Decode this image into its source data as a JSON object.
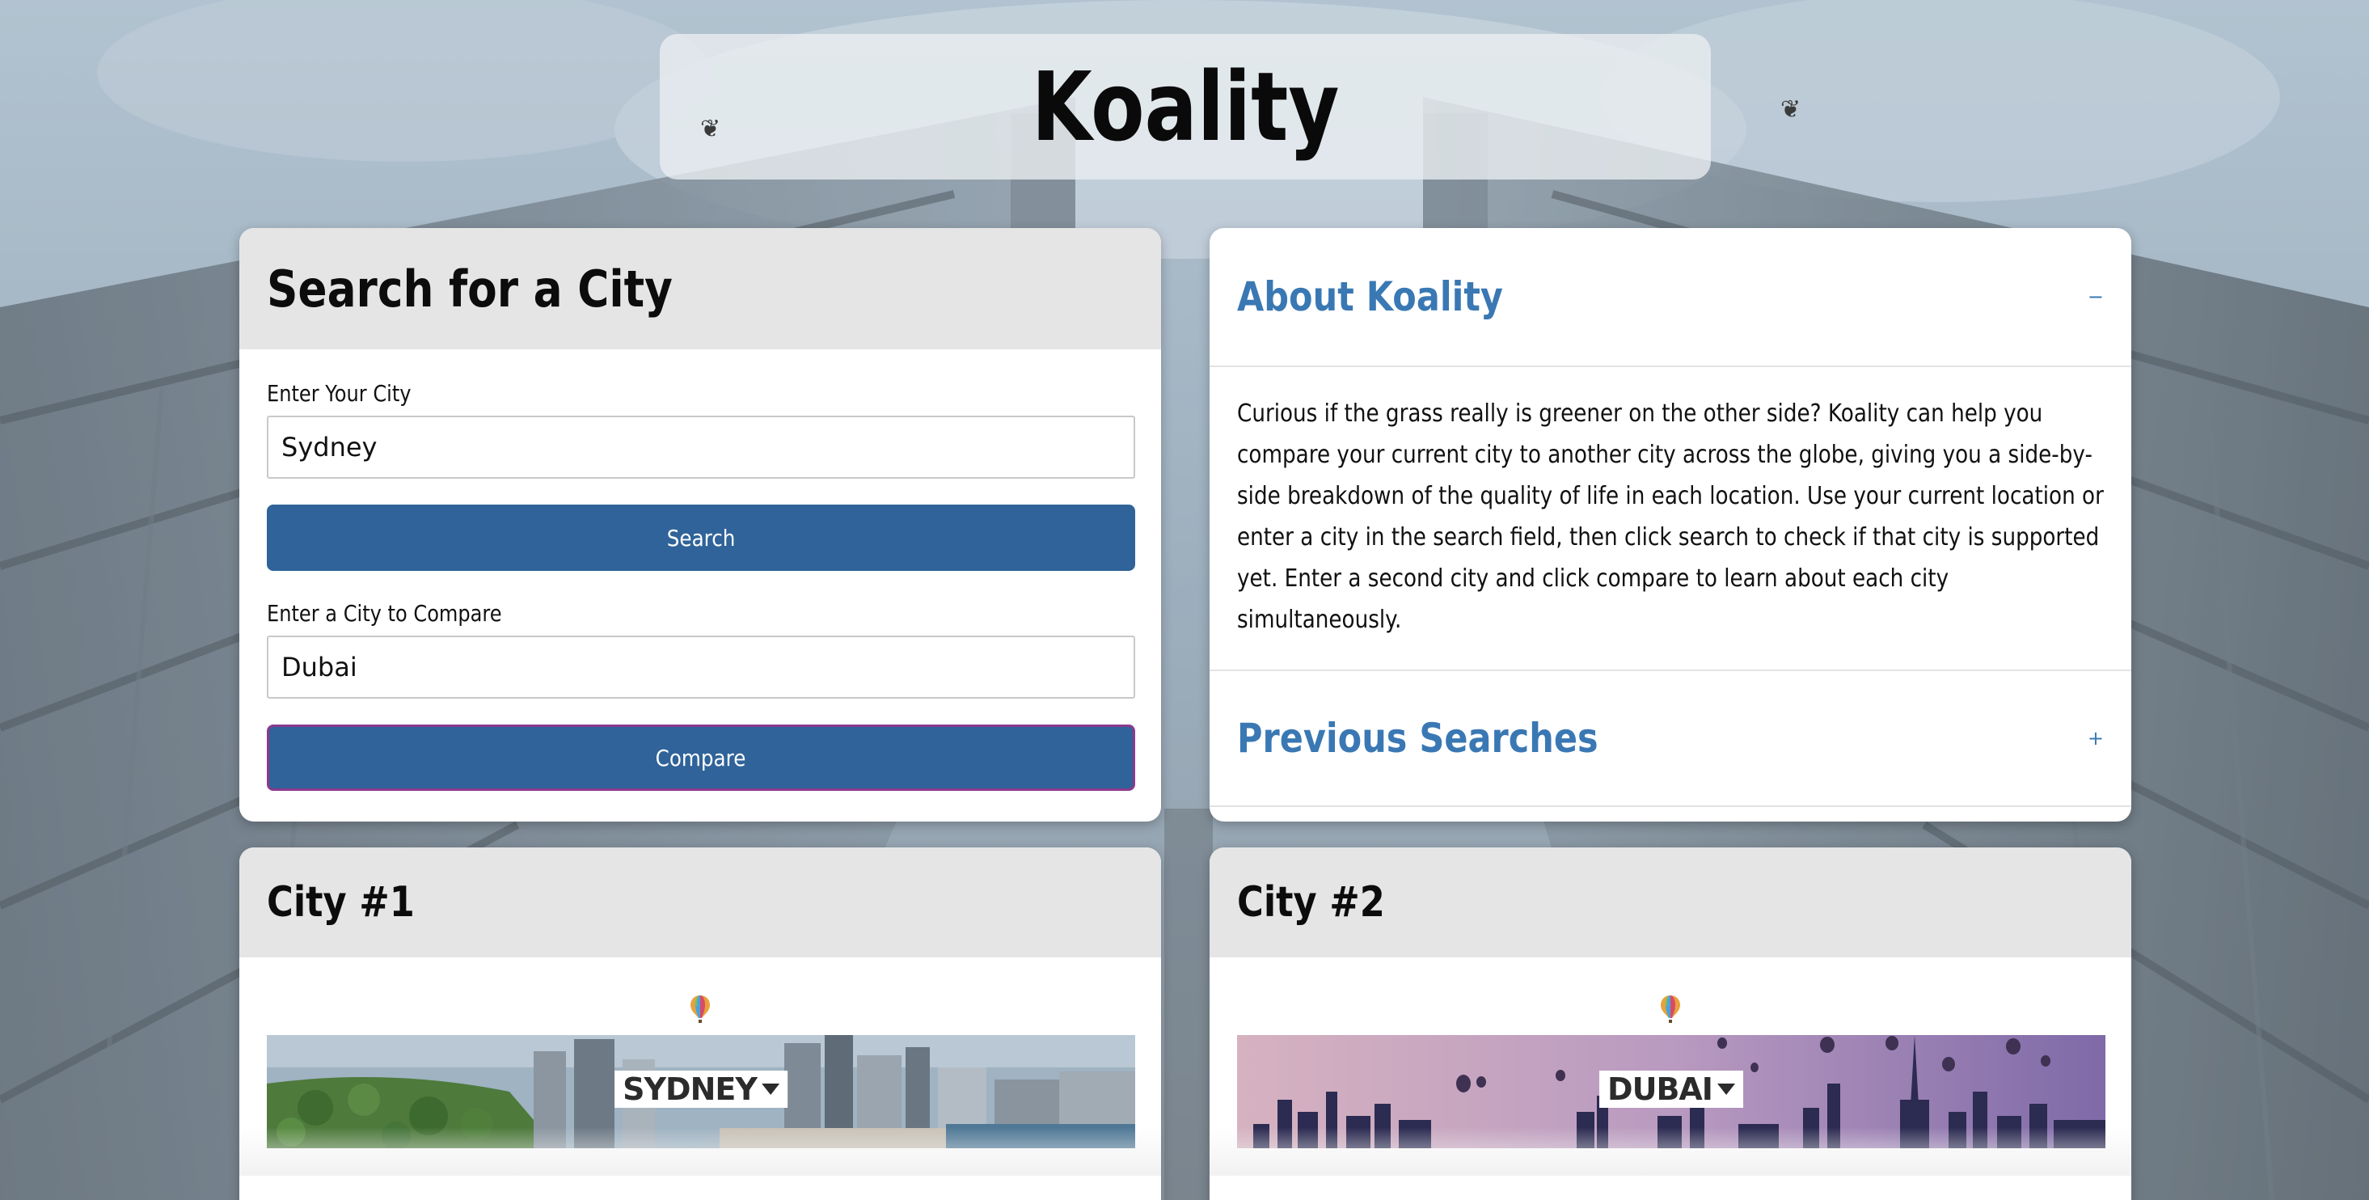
{
  "app": {
    "title": "Koality"
  },
  "search_card": {
    "heading": "Search for a City",
    "city_label": "Enter Your City",
    "city_value": "Sydney",
    "search_button": "Search",
    "compare_label": "Enter a City to Compare",
    "compare_value": "Dubai",
    "compare_button": "Compare"
  },
  "about_card": {
    "about_title": "About Koality",
    "about_toggle": "−",
    "about_text": "Curious if the grass really is greener on the other side? Koality can help you compare your current city to another city across the globe, giving you a side-by-side breakdown of the quality of life in each location. Use your current location or enter a city in the search field, then click search to check if that city is supported yet. Enter a second city and click compare to learn about each city simultaneously.",
    "previous_title": "Previous Searches",
    "previous_toggle": "+"
  },
  "city1": {
    "heading": "City #1",
    "banner_label": "SYDNEY"
  },
  "city2": {
    "heading": "City #2",
    "banner_label": "DUBAI"
  },
  "colors": {
    "primary_button": "#2f6399",
    "accordion_title": "#3a78b4",
    "card_header": "#e5e5e5"
  },
  "icons": {
    "balloon": "hot-air-balloon-icon",
    "caret": "caret-down-icon"
  }
}
